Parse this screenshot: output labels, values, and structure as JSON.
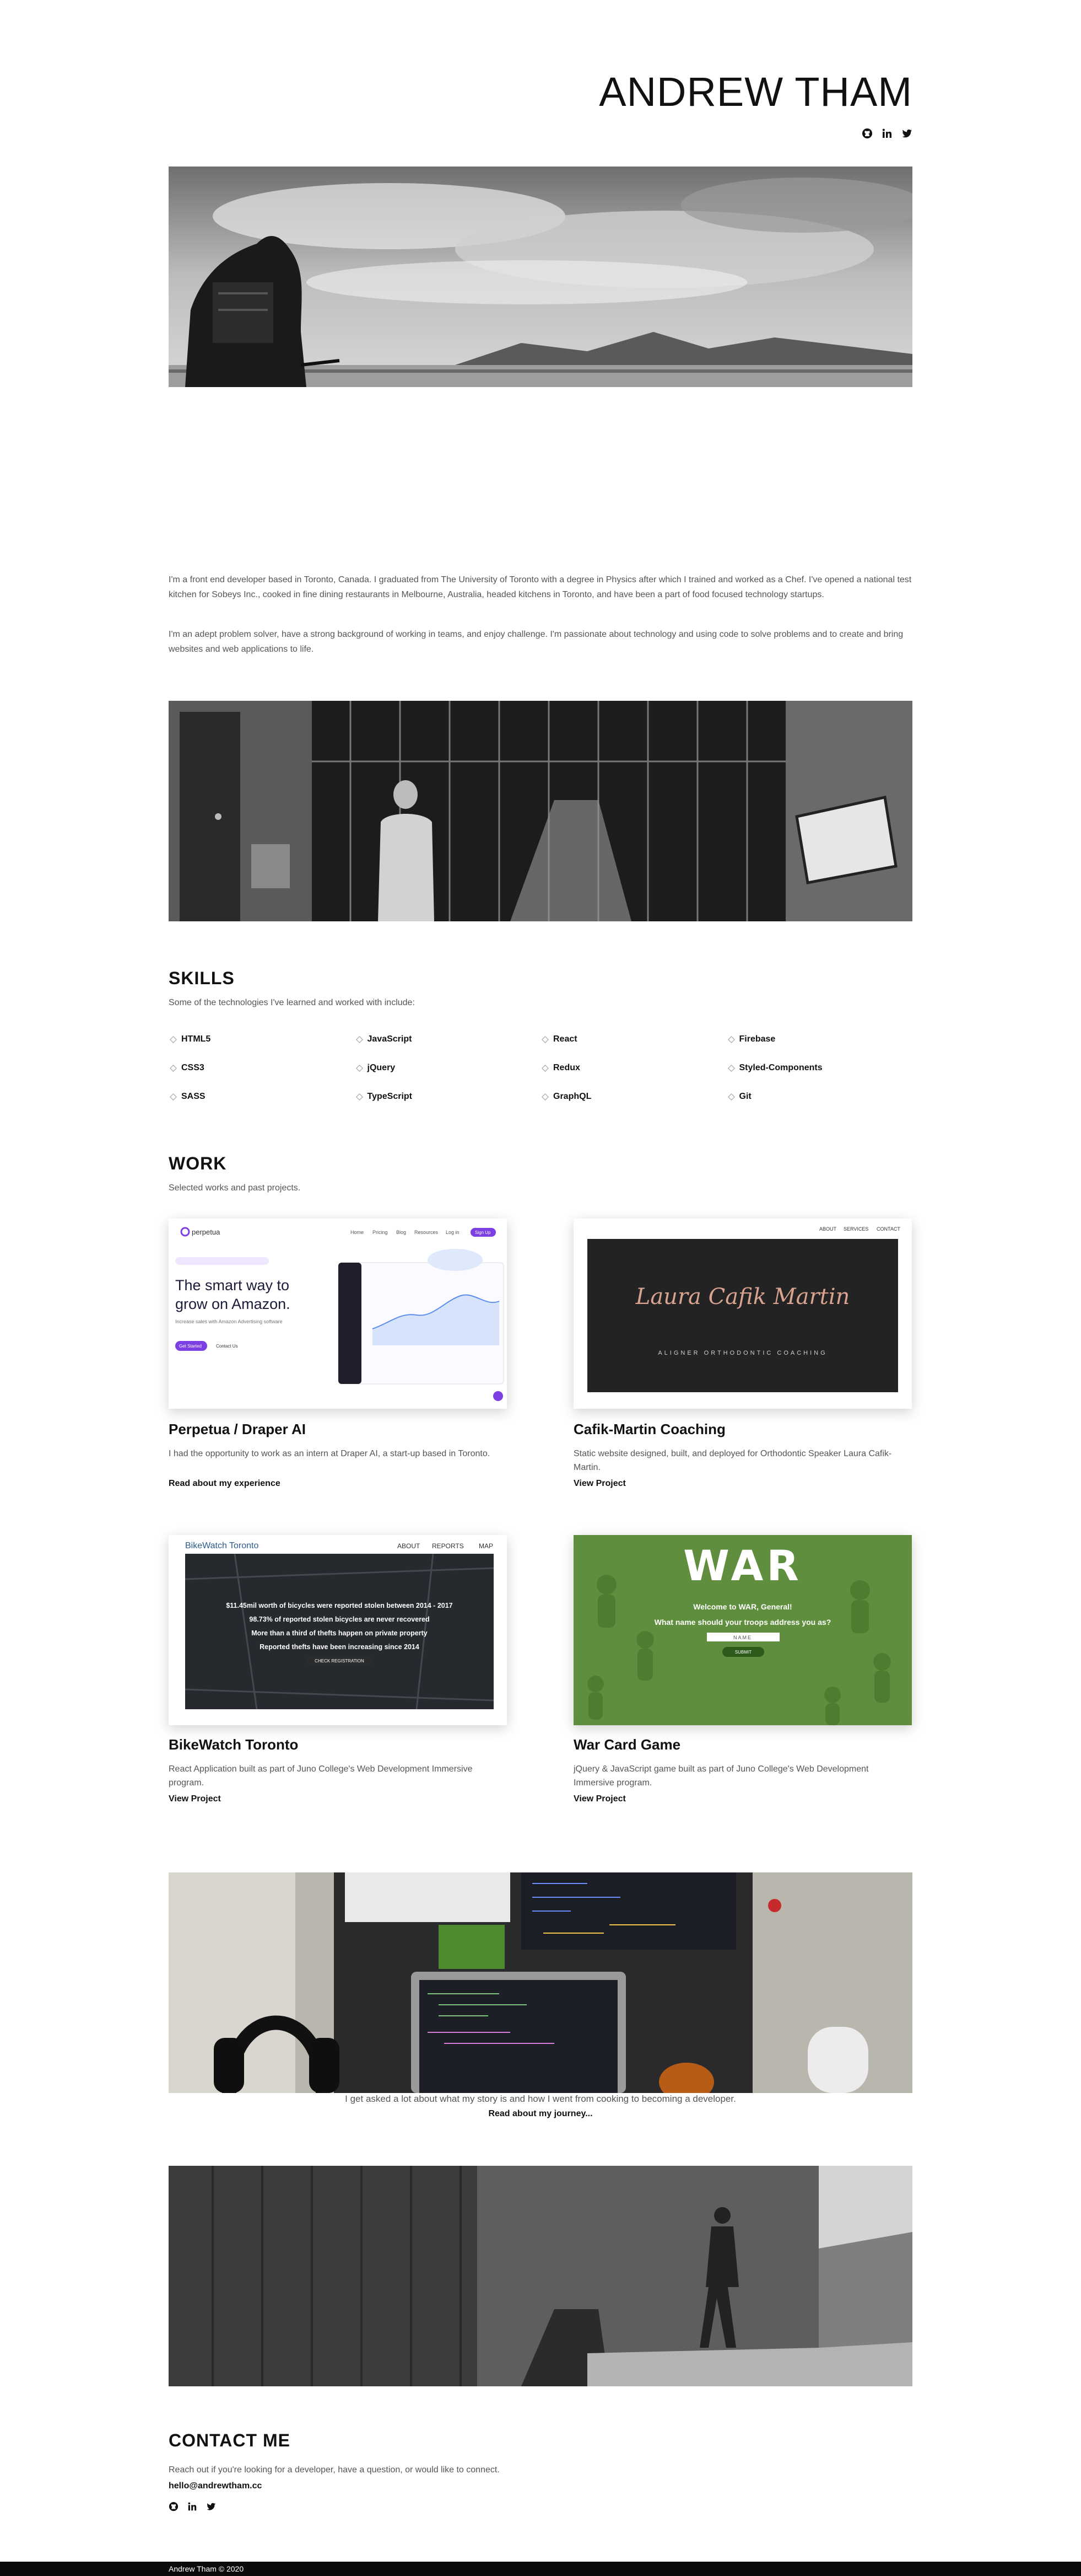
{
  "header": {
    "title": "ANDREW THAM",
    "social_icons": [
      "github-icon",
      "linkedin-icon",
      "twitter-icon"
    ]
  },
  "about": {
    "paragraph1": "I'm a front end developer based in Toronto, Canada. I graduated from The University of Toronto with a degree in Physics after which I trained and worked as a Chef. I've opened a national test kitchen for Sobeys Inc., cooked in fine dining restaurants in Melbourne, Australia, headed kitchens in Toronto, and have been a part of food focused technology startups.",
    "paragraph2": "I'm an adept problem solver, have a strong background of working in teams, and enjoy challenge. I'm passionate about technology and using code to solve problems and to create and bring websites and web applications to life."
  },
  "skills": {
    "title": "SKILLS",
    "subtitle": "Some of the technologies I've learned and worked with include:",
    "items": [
      "HTML5",
      "JavaScript",
      "React",
      "Firebase",
      "CSS3",
      "jQuery",
      "Redux",
      "Styled-Components",
      "SASS",
      "TypeScript",
      "GraphQL",
      "Git"
    ]
  },
  "work": {
    "title": "WORK",
    "subtitle": "Selected works and past projects.",
    "projects": [
      {
        "title": "Perpetua / Draper AI",
        "description": "I had the opportunity to work as an intern at Draper AI, a start-up based in Toronto.",
        "link": "Read about my experience",
        "preview": {
          "logo": "perpetua",
          "nav": [
            "Home",
            "Pricing",
            "Blog",
            "Resources",
            "Log in",
            "Sign Up"
          ],
          "headline1": "The smart way to",
          "headline2": "grow on Amazon.",
          "subline": "Increase sales with Amazon Advertising software",
          "cta": "Get Started",
          "cta2": "Contact Us"
        }
      },
      {
        "title": "Cafik-Martin Coaching",
        "description": "Static website designed, built, and deployed for Orthodontic Speaker Laura Cafik-Martin.",
        "link": "View Project",
        "preview": {
          "nav": [
            "ABOUT",
            "SERVICES",
            "CONTACT"
          ],
          "script_name": "Laura Cafik Martin",
          "tagline": "ALIGNER ORTHODONTIC COACHING"
        }
      },
      {
        "title": "BikeWatch Toronto",
        "description": "React Application built as part of Juno College's Web Development Immersive program.",
        "link": "View Project",
        "preview": {
          "logo": "BikeWatch Toronto",
          "nav": [
            "ABOUT",
            "REPORTS",
            "MAP"
          ],
          "lines": [
            "$11.45mil worth of bicycles were reported stolen between 2014 - 2017",
            "98.73% of reported stolen bicycles are never recovered",
            "More than a third of thefts happen on private property",
            "Reported thefts have been increasing since 2014"
          ],
          "cta": "CHECK REGISTRATION"
        }
      },
      {
        "title": "War Card Game",
        "description": "jQuery & JavaScript game built as part of Juno College's Web Development Immersive program.",
        "link": "View Project",
        "preview": {
          "heading": "WAR",
          "line1": "Welcome to WAR, General!",
          "line2": "What name should your troops address you as?",
          "input_placeholder": "NAME",
          "button": "SUBMIT"
        }
      }
    ]
  },
  "story": {
    "text": "I get asked a lot about what my story is and how I went from cooking to becoming a developer.",
    "link": "Read about my journey..."
  },
  "contact": {
    "title": "CONTACT ME",
    "subtitle": "Reach out if you're looking for a developer, have a question, or would like to connect.",
    "email": "hello@andrewtham.cc"
  },
  "footer": {
    "text": "Andrew Tham © 2020"
  },
  "colors": {
    "text": "#222222",
    "muted": "#555555",
    "accent_purple": "#7b3fe4",
    "war_green": "#5f8f3e",
    "footer_bg": "#0b0b0b"
  }
}
